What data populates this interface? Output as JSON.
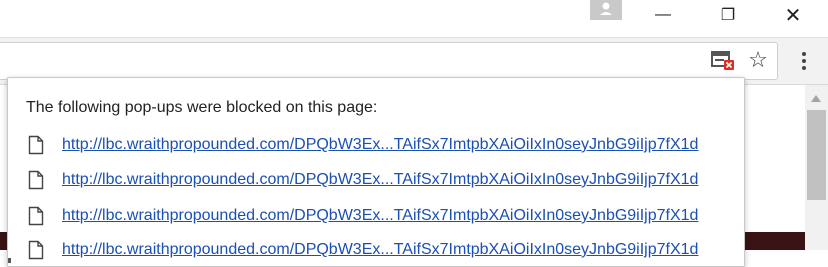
{
  "window": {
    "controls": {
      "minimize_icon": "minimize-icon",
      "maximize_icon": "maximize-icon",
      "close_icon": "close-icon",
      "minimize_glyph": "—",
      "maximize_glyph": "❐",
      "close_glyph": "✕"
    }
  },
  "toolbar": {
    "popup_blocked_icon": "popup-blocked-icon",
    "bookmark_glyph": "☆"
  },
  "popup_bubble": {
    "title": "The following pop-ups were blocked on this page:",
    "links": [
      "http://lbc.wraithpropounded.com/DPQbW3Ex...TAifSx7ImtpbXAiOiIxIn0seyJnbG9iIjp7fX1d",
      "http://lbc.wraithpropounded.com/DPQbW3Ex...TAifSx7ImtpbXAiOiIxIn0seyJnbG9iIjp7fX1d",
      "http://lbc.wraithpropounded.com/DPQbW3Ex...TAifSx7ImtpbXAiOiIxIn0seyJnbG9iIjp7fX1d",
      "http://lbc.wraithpropounded.com/DPQbW3Ex...TAifSx7ImtpbXAiOiIxIn0seyJnbG9iIjp7fX1d"
    ]
  },
  "colors": {
    "link": "#1a4fb4",
    "blocked_badge": "#d93025"
  }
}
